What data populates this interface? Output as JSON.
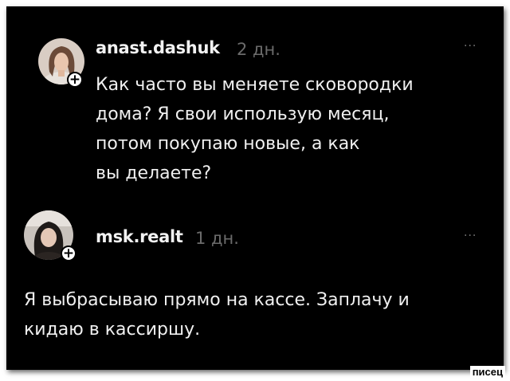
{
  "posts": [
    {
      "username": "anast.dashuk",
      "time": "2 дн.",
      "text": "Как часто вы меняете сковородки\nдома? Я свои использую месяц,\nпотом покупаю новые, а как\nвы делаете?",
      "more": "···",
      "follow": "+"
    },
    {
      "username": "msk.realt",
      "time": "1 дн.",
      "text": "Я выбрасываю прямо на кассе. Заплачу и\nкидаю в кассиршу.",
      "more": "···",
      "follow": "+"
    }
  ],
  "watermark": "писец",
  "colors": {
    "background": "#000000",
    "text": "#f0f0f0",
    "muted": "#6b6b6b"
  }
}
